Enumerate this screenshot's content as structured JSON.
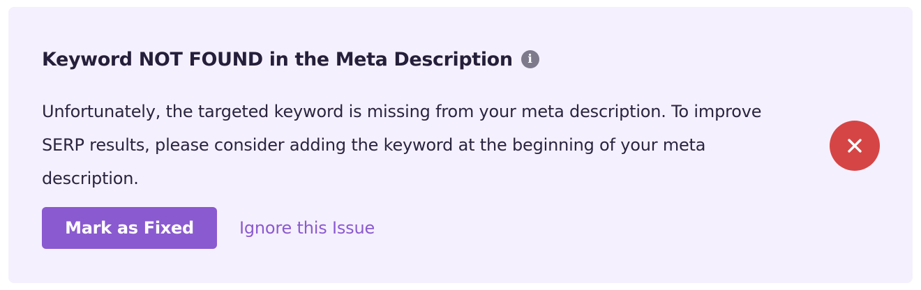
{
  "issue": {
    "title": "Keyword NOT FOUND in the Meta Description",
    "info_icon": "info-icon",
    "message": "Unfortunately, the targeted keyword is missing from your meta description. To improve SERP results, please consider adding the keyword at the beginning of your meta description.",
    "status_icon": "close-icon",
    "status_color": "#d64545"
  },
  "actions": {
    "mark_fixed_label": "Mark as Fixed",
    "ignore_label": "Ignore this Issue"
  },
  "colors": {
    "card_background": "#f5f0fd",
    "accent": "#8a5ad0",
    "error": "#d64545",
    "text": "#261f3b"
  }
}
